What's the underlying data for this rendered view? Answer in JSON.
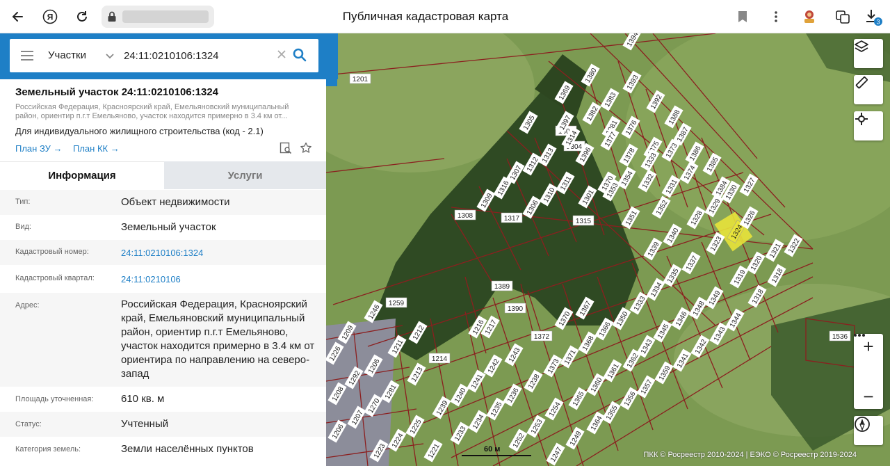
{
  "browser": {
    "page_title": "Публичная кадастровая карта",
    "downloads_badge": "3",
    "icons": [
      "back-icon",
      "yandex-icon",
      "reload-icon",
      "lock-icon",
      "bookmark-icon",
      "extension-icon",
      "translate-icon",
      "downloads-icon"
    ]
  },
  "search": {
    "layer_selected": "Участки",
    "query": "24:11:0210106:1324"
  },
  "card": {
    "title": "Земельный участок 24:11:0210106:1324",
    "address_line": "Российская Федерация, Красноярский край, Емельяновский муниципальный район, ориентир п.г.т Емельяново, участок находится примерно в 3.4 км от...",
    "usage": "Для индивидуального жилищного строительства (код - 2.1)",
    "plan_zu": "План ЗУ",
    "plan_kk": "План КК"
  },
  "tabs": {
    "info": "Информация",
    "services": "Услуги"
  },
  "info_rows": [
    {
      "label": "Тип:",
      "value": "Объект недвижимости"
    },
    {
      "label": "Вид:",
      "value": "Земельный участок"
    },
    {
      "label": "Кадастровый номер:",
      "value": "24:11:0210106:1324"
    },
    {
      "label": "Кадастровый квартал:",
      "value": "24:11:0210106"
    },
    {
      "label": "Адрес:",
      "value": "Российская Федерация, Красноярский край, Емельяновский муниципальный район, ориентир п.г.т Емельяново, участок находится примерно в 3.4 км от ориентира по направлению на северо-запад"
    },
    {
      "label": "Площадь уточненная:",
      "value": "610 кв. м"
    },
    {
      "label": "Статус:",
      "value": "Учтенный"
    },
    {
      "label": "Категория земель:",
      "value": "Земли населённых пунктов"
    }
  ],
  "map": {
    "scale_label": "60 м",
    "copyright": "ПКК © Росреестр 2010-2024 | ЕЭКО © Росреестр 2019-2024",
    "highlight_color": "#e8e43a",
    "parcel_border_color": "#8b1f1f",
    "parcels": [
      "1201",
      "1380",
      "1383",
      "1393",
      "1394",
      "1392",
      "1388",
      "1387",
      "1386",
      "1385",
      "1384",
      "1382",
      "1381",
      "1377",
      "1378",
      "1376",
      "1375",
      "1374",
      "1373",
      "1372",
      "1371",
      "1370",
      "1369",
      "1368",
      "1367",
      "1366",
      "1365",
      "1364",
      "1363",
      "1362",
      "1361",
      "1360",
      "1359",
      "1358",
      "1357",
      "1356",
      "1355",
      "1354",
      "1353",
      "1352",
      "1351",
      "1350",
      "1349",
      "1348",
      "1347",
      "1346",
      "1345",
      "1344",
      "1343",
      "1342",
      "1341",
      "1340",
      "1339",
      "1338",
      "1337",
      "1336",
      "1335",
      "1334",
      "1333",
      "1332",
      "1331",
      "1330",
      "1329",
      "1328",
      "1327",
      "1326",
      "1325",
      "1324",
      "1323",
      "1322",
      "1321",
      "1320",
      "1319",
      "1318",
      "1317",
      "1316",
      "1315",
      "1314",
      "1313",
      "1312",
      "1311",
      "1310",
      "1309",
      "1308",
      "1307",
      "1306",
      "1305",
      "1304",
      "1390",
      "1389",
      "1259",
      "1246",
      "1216",
      "1217",
      "1214",
      "1213",
      "1212",
      "1211",
      "1209",
      "1208",
      "1207",
      "1206",
      "1226",
      "1270",
      "1281",
      "1225",
      "1221",
      "1222",
      "1223",
      "1224",
      "1233",
      "1234",
      "1235",
      "1236",
      "1237",
      "1238",
      "1239",
      "1240",
      "1241",
      "1242",
      "1243",
      "1244",
      "1245",
      "1247",
      "1248",
      "1249",
      "1250",
      "1251",
      "1252",
      "1253",
      "1254",
      "1536"
    ]
  }
}
